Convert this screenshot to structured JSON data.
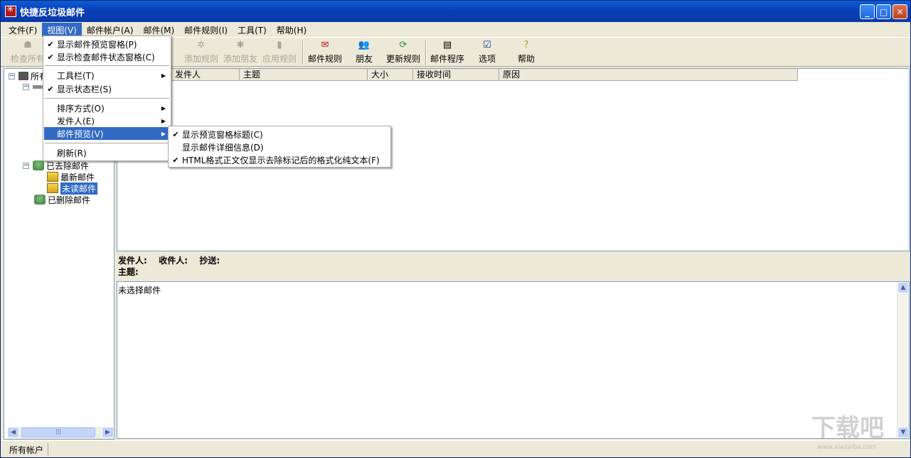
{
  "window": {
    "title": "快捷反垃圾邮件",
    "buttons": [
      "_",
      "□",
      "✕"
    ]
  },
  "menubar": [
    {
      "label": "文件(F)"
    },
    {
      "label": "视图(V)"
    },
    {
      "label": "邮件帐户(A)"
    },
    {
      "label": "邮件(M)"
    },
    {
      "label": "邮件规则(I)"
    },
    {
      "label": "工具(T)"
    },
    {
      "label": "帮助(H)"
    }
  ],
  "toolbar": {
    "check_all": "检查所有",
    "add_rule": "添加规则",
    "add_friend": "添加朋友",
    "apply_rule": "应用规则",
    "mail_rules": "邮件规则",
    "friends": "朋友",
    "update_rules": "更新规则",
    "mail_program": "邮件程序",
    "options": "选项",
    "help": "帮助"
  },
  "tree": {
    "root": "所有帐户",
    "removed_folder": "已去除邮件",
    "newest": "最新邮件",
    "unread": "未读邮件",
    "deleted": "已删除邮件"
  },
  "list_columns": [
    "发件人",
    "主题",
    "大小",
    "接收时间",
    "原因"
  ],
  "preview": {
    "from_label": "发件人:",
    "to_label": "收件人:",
    "cc_label": "抄送:",
    "subject_label": "主题:",
    "body": "未选择邮件"
  },
  "status": {
    "panel": "所有帐户"
  },
  "view_menu": {
    "items": [
      {
        "label": "显示邮件预览窗格(P)",
        "checked": true
      },
      {
        "label": "显示检查邮件状态窗格(C)",
        "checked": true
      },
      {
        "label": "工具栏(T)",
        "checked": false,
        "submenu": true
      },
      {
        "label": "显示状态栏(S)",
        "checked": true
      },
      {
        "label": "排序方式(O)",
        "checked": false,
        "submenu": true
      },
      {
        "label": "发件人(E)",
        "checked": false,
        "submenu": true
      },
      {
        "label": "邮件预览(V)",
        "checked": false,
        "submenu": true,
        "highlighted": true
      },
      {
        "label": "刷新(R)",
        "checked": false
      }
    ]
  },
  "preview_submenu": {
    "items": [
      {
        "label": "显示预览窗格标题(C)",
        "checked": true
      },
      {
        "label": "显示邮件详细信息(D)",
        "checked": false
      },
      {
        "label": "HTML格式正文仅显示去除标记后的格式化纯文本(F)",
        "checked": true
      }
    ]
  },
  "watermarks": {
    "site_logo": "下载吧",
    "site_url": "www.xiazaiba.com"
  },
  "colors": {
    "selection": "#316ac5",
    "titlebar": "#0a5fd8",
    "face": "#ece9d8"
  }
}
